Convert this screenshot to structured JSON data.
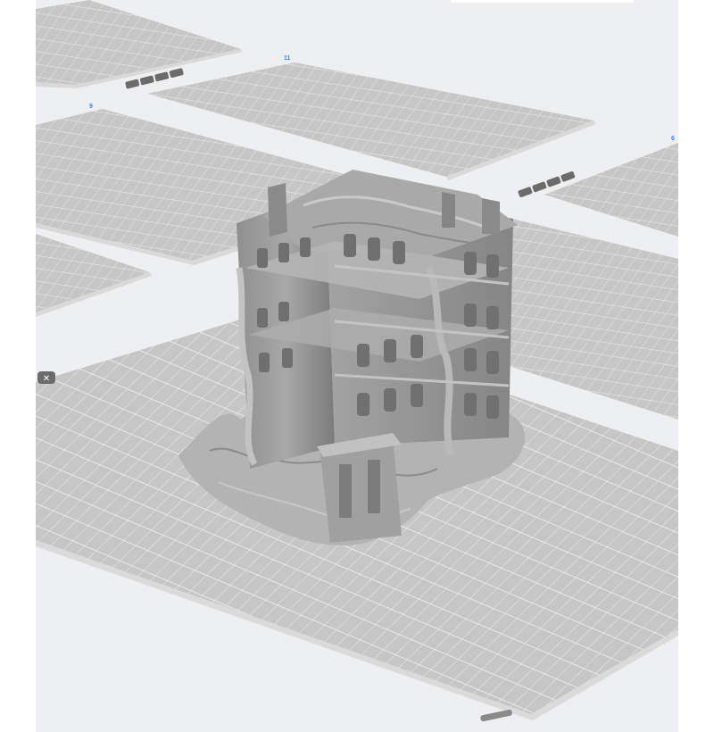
{
  "viewport": {
    "title": "",
    "background": "#eeeff0",
    "plate_fill": "#c6c6c6",
    "grid_color": "#ededed",
    "model_color": "#9a9a9a"
  },
  "plates": [
    {
      "id": "plate-top-left",
      "label": ""
    },
    {
      "id": "plate-top-center",
      "label": "11"
    },
    {
      "id": "plate-middle-left",
      "label": "9"
    },
    {
      "id": "plate-right-upper",
      "label": "6"
    },
    {
      "id": "plate-main",
      "label": ""
    }
  ],
  "plate_tools": {
    "icons": [
      "arrange-icon",
      "orient-icon",
      "lock-icon",
      "close-icon"
    ]
  },
  "delete_glyph": "✕"
}
